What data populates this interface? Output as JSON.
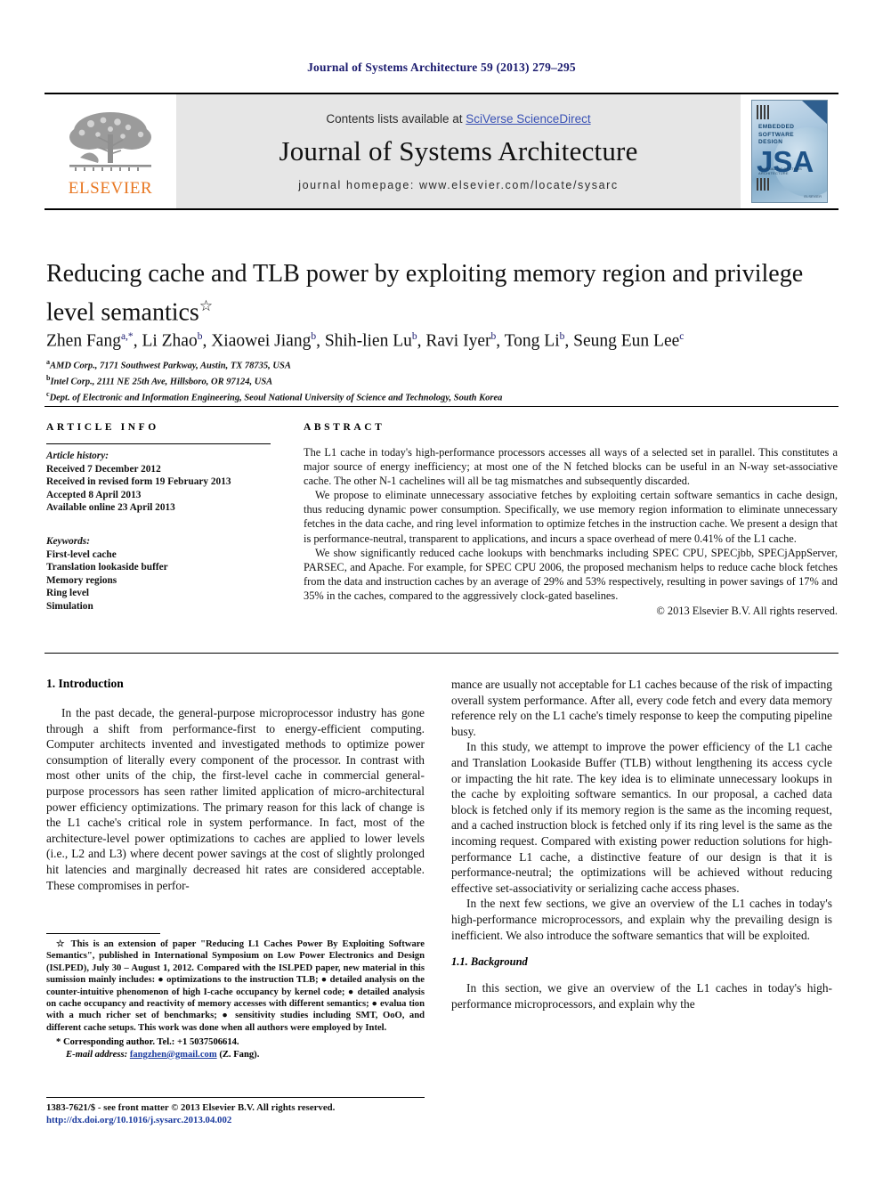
{
  "running_head": "Journal of Systems Architecture 59 (2013) 279–295",
  "masthead": {
    "contents_prefix": "Contents lists available at ",
    "sciencedirect_link": "SciVerse ScienceDirect",
    "journal_name": "Journal of Systems Architecture",
    "homepage": "journal homepage: www.elsevier.com/locate/sysarc",
    "publisher_logo_text": "ELSEVIER",
    "cover": {
      "subtitle_lines": "EMBEDDED\nSOFTWARE\nDESIGN",
      "acronym": "JSA",
      "tiny_line": "JOURNAL OF SYSTEMS ARCHITECTURE",
      "foot_mark": "ELSEVIER"
    }
  },
  "article": {
    "title": "Reducing cache and TLB power by exploiting memory region and privilege level semantics",
    "title_mark": "☆",
    "authors_line": "Zhen Fang a,*, Li Zhao b, Xiaowei Jiang b, Shih-lien Lu b, Ravi Iyer b, Tong Li b, Seung Eun Lee c",
    "affiliations": [
      {
        "marker": "a",
        "text": "AMD Corp., 7171 Southwest Parkway, Austin, TX 78735, USA"
      },
      {
        "marker": "b",
        "text": "Intel Corp., 2111 NE 25th Ave, Hillsboro, OR 97124, USA"
      },
      {
        "marker": "c",
        "text": "Dept. of Electronic and Information Engineering, Seoul National University of Science and Technology, South Korea"
      }
    ]
  },
  "info": {
    "heading": "ARTICLE INFO",
    "history_label": "Article history:",
    "history": [
      "Received 7 December 2012",
      "Received in revised form 19 February 2013",
      "Accepted 8 April 2013",
      "Available online 23 April 2013"
    ],
    "keywords_label": "Keywords:",
    "keywords": [
      "First-level cache",
      "Translation lookaside buffer",
      "Memory regions",
      "Ring level",
      "Simulation"
    ]
  },
  "abstract": {
    "heading": "ABSTRACT",
    "paragraphs": [
      "The L1 cache in today's high-performance processors accesses all ways of a selected set in parallel. This constitutes a major source of energy inefficiency; at most one of the N fetched blocks can be useful in an N-way set-associative cache. The other N-1 cachelines will all be tag mismatches and subsequently discarded.",
      "We propose to eliminate unnecessary associative fetches by exploiting certain software semantics in cache design, thus reducing dynamic power consumption. Specifically, we use memory region information to eliminate unnecessary fetches in the data cache, and ring level information to optimize fetches in the instruction cache. We present a design that is performance-neutral, transparent to applications, and incurs a space overhead of mere 0.41% of the L1 cache.",
      "We show significantly reduced cache lookups with benchmarks including SPEC CPU, SPECjbb, SPECjAppServer, PARSEC, and Apache. For example, for SPEC CPU 2006, the proposed mechanism helps to reduce cache block fetches from the data and instruction caches by an average of 29% and 53% respectively, resulting in power savings of 17% and 35% in the caches, compared to the aggressively clock-gated baselines."
    ],
    "copyright": "© 2013 Elsevier B.V. All rights reserved."
  },
  "body": {
    "section_1_title": "1. Introduction",
    "left_paragraphs": [
      "In the past decade, the general-purpose microprocessor industry has gone through a shift from performance-first to energy-efficient computing. Computer architects invented and investigated methods to optimize power consumption of literally every component of the processor. In contrast with most other units of the chip, the first-level cache in commercial general-purpose processors has seen rather limited application of micro-architectural power efficiency optimizations. The primary reason for this lack of change is the L1 cache's critical role in system performance. In fact, most of the architecture-level power optimizations to caches are applied to lower levels (i.e., L2 and L3) where decent power savings at the cost of slightly prolonged hit latencies and marginally decreased hit rates are considered acceptable. These compromises in perfor-"
    ],
    "right_paragraphs": [
      "mance are usually not acceptable for L1 caches because of the risk of impacting overall system performance. After all, every code fetch and every data memory reference rely on the L1 cache's timely response to keep the computing pipeline busy.",
      "In this study, we attempt to improve the power efficiency of the L1 cache and Translation Lookaside Buffer (TLB) without lengthening its access cycle or impacting the hit rate. The key idea is to eliminate unnecessary lookups in the cache by exploiting software semantics. In our proposal, a cached data block is fetched only if its memory region is the same as the incoming request, and a cached instruction block is fetched only if its ring level is the same as the incoming request. Compared with existing power reduction solutions for high-performance L1 cache, a distinctive feature of our design is that it is performance-neutral; the optimizations will be achieved without reducing effective set-associativity or serializing cache access phases.",
      "In the next few sections, we give an overview of the L1 caches in today's high-performance microprocessors, and explain why the prevailing design is inefficient. We also introduce the software semantics that will be exploited."
    ],
    "subsection_1_1_title": "1.1. Background",
    "right_paragraphs_after_sub": [
      "In this section, we give an overview of the L1 caches in today's high-performance microprocessors, and explain why the"
    ]
  },
  "footnotes": {
    "star_note": "☆ This is an extension of paper \"Reducing L1 Caches Power By Exploiting Software Semantics\", published in International Symposium on Low Power Electronics and Design (ISLPED), July 30 – August 1, 2012. Compared with the ISLPED paper, new material in this sumission mainly includes: ● optimizations to the instruction TLB; ● detailed analysis on the counter-intuitive phenomenon of high I-cache occupancy by kernel code; ● detailed analysis on cache occupancy and reactivity of memory accesses with different semantics; ● evalua tion with a much richer set of benchmarks; ● sensitivity studies including SMT, OoO, and different cache setups. This work was done when all authors were employed by Intel.",
    "corresponding": "* Corresponding author. Tel.: +1 5037506614.",
    "email_label": "E-mail address:",
    "email": "fangzhen@gmail.com",
    "email_suffix": "(Z. Fang)."
  },
  "imprint": {
    "line1": "1383-7621/$ - see front matter © 2013 Elsevier B.V. All rights reserved.",
    "line2": "http://dx.doi.org/10.1016/j.sysarc.2013.04.002"
  },
  "colors": {
    "link": "#3a52b5",
    "running_head": "#1a1a6e",
    "elsevier_orange": "#E87722",
    "masthead_bg": "#e6e6e6"
  }
}
